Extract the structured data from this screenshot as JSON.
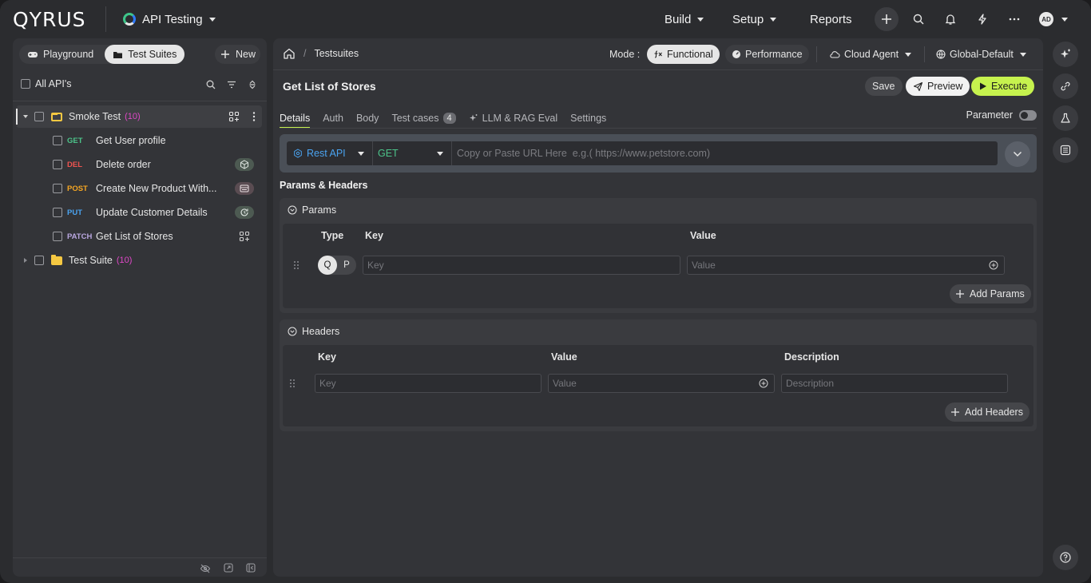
{
  "app": {
    "logo": "QYRUS",
    "product": "API Testing",
    "nav": [
      "Build",
      "Setup",
      "Reports"
    ],
    "avatar_initials": "AD"
  },
  "sidebar": {
    "segments": [
      "Playground",
      "Test Suites"
    ],
    "new_label": "New",
    "all_apis_label": "All API's",
    "suites": [
      {
        "name": "Smoke Test",
        "count": "(10)",
        "items": [
          {
            "method": "GET",
            "name": "Get User profile"
          },
          {
            "method": "DEL",
            "name": "Delete order"
          },
          {
            "method": "POST",
            "name": "Create New Product With..."
          },
          {
            "method": "PUT",
            "name": "Update Customer Details"
          },
          {
            "method": "PATCH",
            "name": "Get List of Stores"
          }
        ]
      },
      {
        "name": "Test Suite",
        "count": "(10)"
      }
    ]
  },
  "main": {
    "breadcrumb": "Testsuites",
    "mode_label": "Mode :",
    "modes": [
      "Functional",
      "Performance"
    ],
    "agent": "Cloud Agent",
    "environment": "Global-Default",
    "title": "Get List of Stores",
    "actions": {
      "save": "Save",
      "preview": "Preview",
      "execute": "Execute"
    },
    "tabs": [
      "Details",
      "Auth",
      "Body",
      "Test cases",
      "LLM & RAG Eval",
      "Settings"
    ],
    "test_cases_count": "4",
    "parameter_label": "Parameter",
    "url": {
      "api_type": "Rest API",
      "method": "GET",
      "placeholder": "Copy or Paste URL Here  e.g.( https://www.petstore.com)"
    },
    "params_headers_title": "Params & Headers",
    "params": {
      "title": "Params",
      "columns": [
        "Type",
        "Key",
        "Value"
      ],
      "type_options": [
        "Q",
        "P"
      ],
      "key_placeholder": "Key",
      "value_placeholder": "Value",
      "add_label": "Add Params"
    },
    "headers": {
      "title": "Headers",
      "columns": [
        "Key",
        "Value",
        "Description"
      ],
      "key_placeholder": "Key",
      "value_placeholder": "Value",
      "description_placeholder": "Description",
      "add_label": "Add Headers"
    }
  },
  "colors": {
    "accent": "#c6f24e",
    "get": "#4cc38a",
    "delete": "#ef5350",
    "post": "#f5a623",
    "put": "#4aa3f0",
    "patch": "#b9a7e0",
    "count": "#e048c8"
  }
}
